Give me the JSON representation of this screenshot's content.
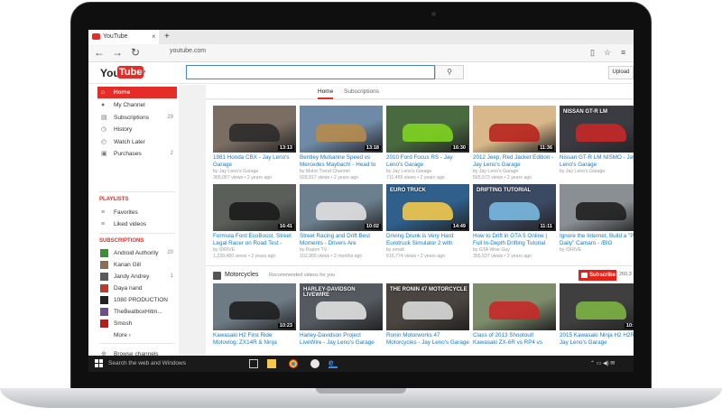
{
  "browser": {
    "tab_title": "YouTube",
    "tab_close": "×",
    "new_tab": "+",
    "back": "←",
    "forward": "→",
    "refresh": "↻",
    "url": "youtube.com"
  },
  "header": {
    "logo_you": "You",
    "logo_tube": "Tube",
    "guide": "≡▾",
    "search_value": "",
    "search_icon": "⚲",
    "upload_label": "Upload"
  },
  "sidebar": {
    "main_items": [
      {
        "label": "Home",
        "icon": "home-icon",
        "glyph": "⌂",
        "count": "",
        "active": true
      },
      {
        "label": "My Channel",
        "icon": "user-icon",
        "glyph": "●",
        "count": ""
      },
      {
        "label": "Subscriptions",
        "icon": "subscriptions-icon",
        "glyph": "▤",
        "count": "29"
      },
      {
        "label": "History",
        "icon": "history-icon",
        "glyph": "◷",
        "count": ""
      },
      {
        "label": "Watch Later",
        "icon": "clock-icon",
        "glyph": "◴",
        "count": ""
      },
      {
        "label": "Purchases",
        "icon": "purchases-icon",
        "glyph": "▣",
        "count": "2"
      }
    ],
    "playlists_heading": "PLAYLISTS",
    "playlist_items": [
      {
        "label": "Favorites",
        "icon": "list-icon",
        "glyph": "≡"
      },
      {
        "label": "Liked videos",
        "icon": "list-icon",
        "glyph": "≡"
      }
    ],
    "subscriptions_heading": "SUBSCRIPTIONS",
    "subscription_items": [
      {
        "label": "Android Authority",
        "count": "20",
        "color": "#3d8b3d"
      },
      {
        "label": "Kanan Gill",
        "count": "",
        "color": "#8a6d52"
      },
      {
        "label": "Jandy Andrey",
        "count": "1",
        "color": "#5a5a5a"
      },
      {
        "label": "Daya nand",
        "count": "",
        "color": "#c0392b"
      },
      {
        "label": "1080 PRODUCTION",
        "count": "",
        "color": "#222222"
      },
      {
        "label": "TheBeatboxHitm...",
        "count": "",
        "color": "#6b4e8a"
      },
      {
        "label": "Smosh",
        "count": "",
        "color": "#b71c1c"
      }
    ],
    "more_label": "More ›",
    "bottom_items": [
      {
        "label": "Browse channels",
        "icon": "plus-circle-icon",
        "glyph": "⊕"
      },
      {
        "label": "Manage subscriptions",
        "icon": "gear-icon",
        "glyph": "⚙"
      }
    ]
  },
  "main": {
    "tabs": [
      "Home",
      "Subscriptions"
    ],
    "row1": [
      {
        "title": "1981 Honda CBX - Jay Leno's Garage",
        "by": "by Jay Leno's Garage",
        "views": "365,057 views",
        "age": "2 years ago",
        "duration": "13:13",
        "bg": "#7a6e63",
        "accent": "#2b2b2b"
      },
      {
        "title": "Bentley Mulsanne Speed vs Mercedes Maybach! - Head to Head",
        "by": "by Motor Trend Channel",
        "views": "929,817 views",
        "age": "2 years ago",
        "duration": "13:18",
        "bg": "#6f8aa6",
        "accent": "#b58a4c"
      },
      {
        "title": "2010 Ford Focus RS - Jay Leno's Garage",
        "by": "by Jay Leno's Garage",
        "views": "711,455 views",
        "age": "2 years ago",
        "duration": "16:30",
        "bg": "#486a3e",
        "accent": "#7ed321"
      },
      {
        "title": "2012 Jeep, Red Jacket Edition - Jay Leno's Garage",
        "by": "by Jay Leno's Garage",
        "views": "565,573 views",
        "age": "2 years ago",
        "duration": "11:36",
        "bg": "#d8b88a",
        "accent": "#b8241d"
      },
      {
        "title": "Nissan GT-R LM NISMO - Jay Leno's Garage",
        "by": "by Jay Leno's Garage",
        "views": "",
        "age": "",
        "duration": "",
        "bg": "#3b3b42",
        "accent": "#c62828",
        "overlay": "NISSAN GT-R LM"
      }
    ],
    "row2": [
      {
        "title": "Formula Ford EcoBoost. Street Legal Racer on Road Test - /DRIVE",
        "by": "by /DRIVE",
        "views": "1,239,480 views",
        "age": "2 years ago",
        "duration": "16:41",
        "bg": "#5b5f5a",
        "accent": "#1b1b1b"
      },
      {
        "title": "Street Racing and Drift Best Moments - Drivers Are",
        "by": "by Rupon TV",
        "views": "102,965 views",
        "age": "2 months ago",
        "duration": "10:02",
        "bg": "#6c7f8e",
        "accent": "#e0e0e0"
      },
      {
        "title": "Driving Drunk is Very Hard: Eurotruck Simulator 2 with Oculus",
        "by": "by ematt",
        "views": "616,774 views",
        "age": "2 years ago",
        "duration": "14:49",
        "bg": "#2f5f8a",
        "accent": "#f2c94c",
        "overlay": "EURO TRUCK"
      },
      {
        "title": "How to Drift in GTA 5 Online | Full In-Depth Drifting Tutorial",
        "by": "by GTA Wise Guy",
        "views": "355,537 views",
        "age": "2 years ago",
        "duration": "11:11",
        "bg": "#3b4a63",
        "accent": "#7ab8e0",
        "overlay": "DRIFTING TUTORIAL"
      },
      {
        "title": "Ignore the Internet. Build a \"Pro Daily\" Camaro - /BIG",
        "by": "by /DRIVE",
        "views": "",
        "age": "",
        "duration": "",
        "bg": "#8a8f94",
        "accent": "#1f1f1f"
      }
    ],
    "section": {
      "title": "Motorcycles",
      "subtitle": "Recommended videos for you",
      "subscribe_label": "Subscribe",
      "subscriber_count": "260,3"
    },
    "row3": [
      {
        "title": "Kawasaki H2 First Ride Motovlog: ZX14R & Ninja",
        "duration": "10:23",
        "bg": "#6e7a84",
        "accent": "#1e1e1e"
      },
      {
        "title": "Harley-Davidson Project LiveWire - Jay Leno's Garage",
        "duration": "",
        "bg": "#545a60",
        "accent": "#e0e0e0",
        "overlay": "HARLEY-DAVIDSON LIVEWIRE"
      },
      {
        "title": "Ronin Motorworks 47 Motorcycles - Jay Leno's Garage",
        "duration": "",
        "bg": "#4a4540",
        "accent": "#d9d9d9",
        "overlay": "THE RONIN 47 MOTORCYCLE"
      },
      {
        "title": "Class of 2013 Shootout! Kawasaki ZX-6R vs RP4 vs BMW",
        "duration": "",
        "bg": "#7d8c6a",
        "accent": "#c62828"
      },
      {
        "title": "2015 Kawasaki Ninja H2 H2R - Jay Leno's Garage",
        "duration": "10:20",
        "bg": "#3f3f3f",
        "accent": "#7cb342"
      }
    ]
  },
  "taskbar": {
    "search_placeholder": "Search the web and Windows",
    "tray_icons": "⌃ ▭ ◀) ✉"
  }
}
